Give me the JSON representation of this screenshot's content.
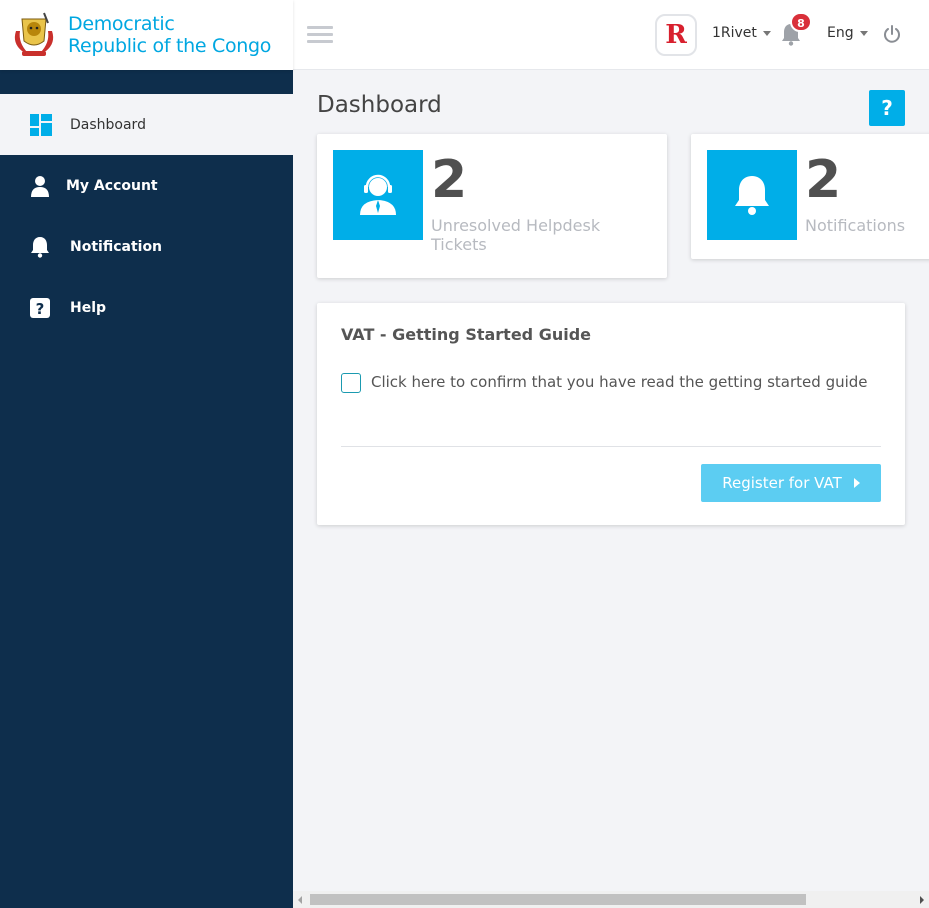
{
  "brand": {
    "line1": "Democratic",
    "line2": "Republic of the Congo"
  },
  "header": {
    "avatar_letter": "R",
    "username": "1Rivet",
    "notification_count": "8",
    "language": "Eng"
  },
  "sidebar": {
    "items": [
      {
        "label": "Dashboard",
        "icon": "dashboard-grid-icon",
        "active": true
      },
      {
        "label": "My Account",
        "icon": "user-icon"
      },
      {
        "label": "Notification",
        "icon": "bell-icon"
      },
      {
        "label": "Help",
        "icon": "question-icon"
      }
    ]
  },
  "main": {
    "title": "Dashboard",
    "help_label": "?",
    "stats": [
      {
        "value": "2",
        "label_line1": "Unresolved Helpdesk",
        "label_line2": "Tickets",
        "icon": "helpdesk-agent-icon"
      },
      {
        "value": "2",
        "label_line1": "Notifications",
        "label_line2": "",
        "icon": "bell-icon"
      }
    ],
    "guide": {
      "title": "VAT - Getting Started Guide",
      "checkbox_label": "Click here to confirm that you have read the getting started guide",
      "button_label": "Register for VAT"
    }
  },
  "colors": {
    "accent": "#00aee8",
    "sidebar_bg": "#0e2e4c",
    "brand_text": "#00a7e1",
    "badge": "#d9303a",
    "button_disabled": "#5ccdf2"
  }
}
